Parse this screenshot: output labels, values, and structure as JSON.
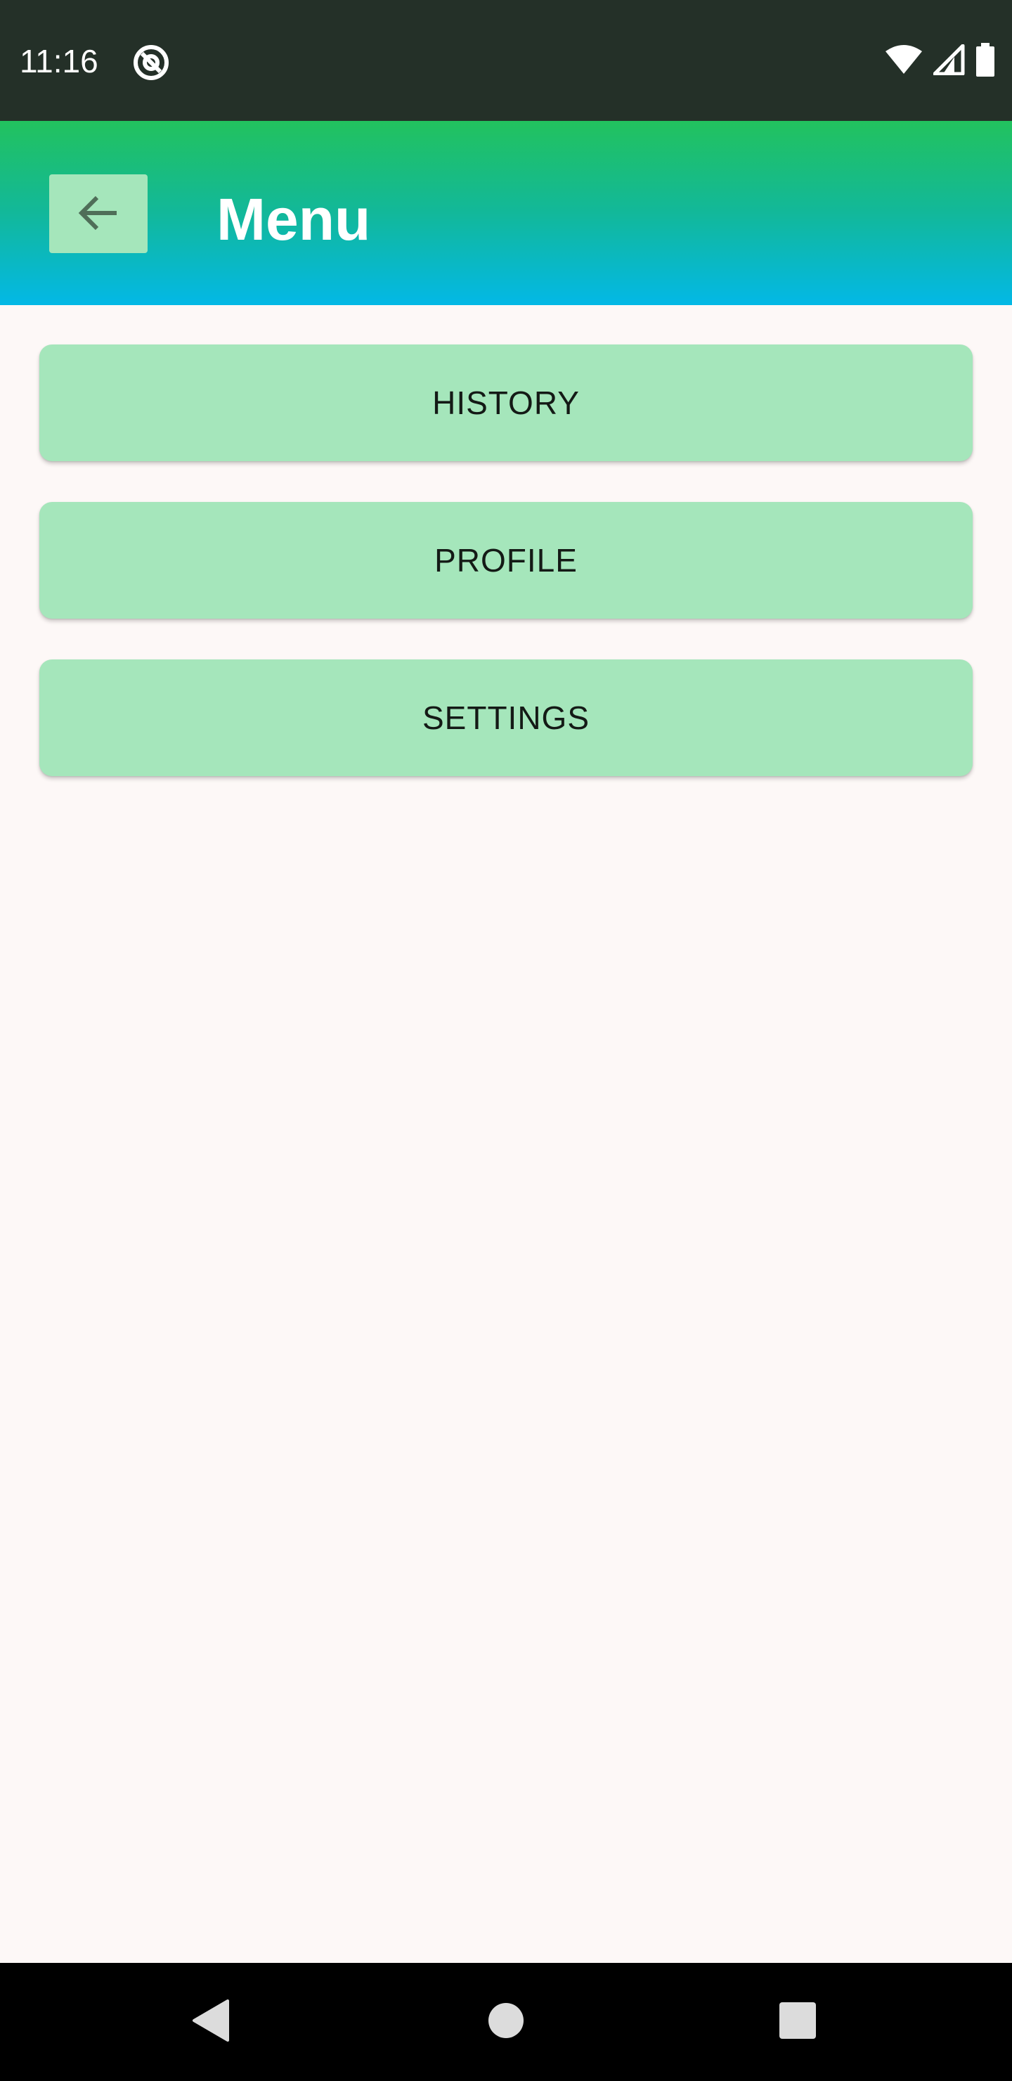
{
  "status_bar": {
    "time": "11:16",
    "icons": [
      "at-sign-icon",
      "wifi-icon",
      "signal-icon",
      "battery-icon"
    ]
  },
  "app_bar": {
    "title": "Menu",
    "back_icon": "arrow-left-icon",
    "gradient": [
      "#22c25e",
      "#03b8e6"
    ]
  },
  "menu": {
    "items": [
      {
        "label": "HISTORY"
      },
      {
        "label": "PROFILE"
      },
      {
        "label": "SETTINGS"
      }
    ],
    "button_color": "#a5e6bb"
  },
  "nav_bar": {
    "icons": [
      "back-triangle-icon",
      "home-circle-icon",
      "recents-square-icon"
    ]
  },
  "colors": {
    "status_bar_bg": "#243028",
    "page_bg": "#fdf8f7",
    "nav_bar_bg": "#000000"
  }
}
